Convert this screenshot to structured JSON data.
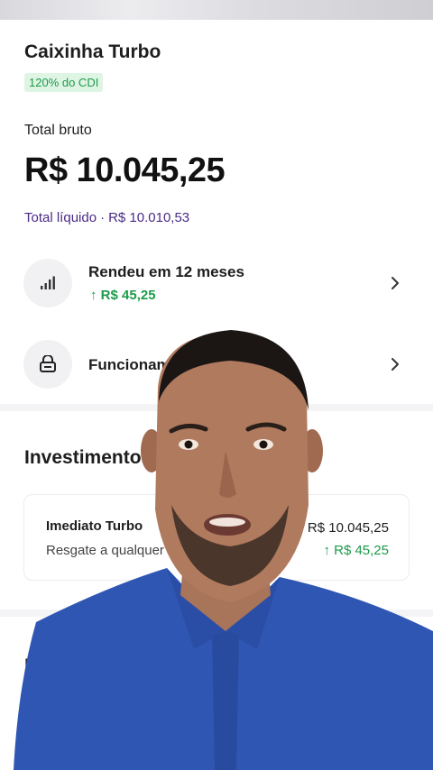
{
  "product": {
    "title": "Caixinha Turbo",
    "rate_badge": "120% do CDI"
  },
  "balance": {
    "gross_label": "Total bruto",
    "gross_amount": "R$ 10.045,25",
    "net_label": "Total líquido",
    "separator": "·",
    "net_amount": "R$ 10.010,53"
  },
  "rows": [
    {
      "title": "Rendeu em 12 meses",
      "value": "R$ 45,25",
      "icon": "signal-bars-icon"
    },
    {
      "title": "Funcionamento da Caixinha",
      "icon": "piggy-lock-icon"
    }
  ],
  "investments": {
    "title": "Investimentos",
    "item": {
      "name": "Imediato Turbo",
      "description": "Resgate a qualquer momento",
      "amount": "R$ 10.045,25",
      "gain": "R$ 45,25"
    }
  },
  "next_section_initial": "H",
  "colors": {
    "accent_purple": "#4b2a86",
    "positive_green": "#1d9a4a",
    "badge_bg": "#dff5e4"
  }
}
